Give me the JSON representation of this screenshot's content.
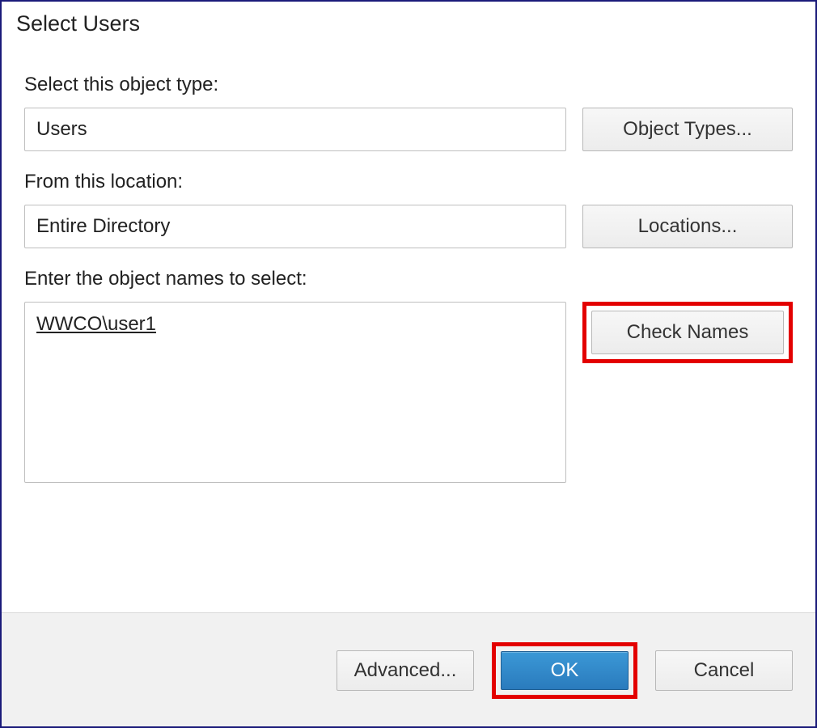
{
  "title": "Select Users",
  "object_type_section": {
    "label": "Select this object type:",
    "value": "Users",
    "button": "Object Types..."
  },
  "location_section": {
    "label": "From this location:",
    "value": "Entire Directory",
    "button": "Locations..."
  },
  "names_section": {
    "label": "Enter the object names to select:",
    "value": "WWCO\\user1",
    "button": "Check Names"
  },
  "footer": {
    "advanced": "Advanced...",
    "ok": "OK",
    "cancel": "Cancel"
  }
}
